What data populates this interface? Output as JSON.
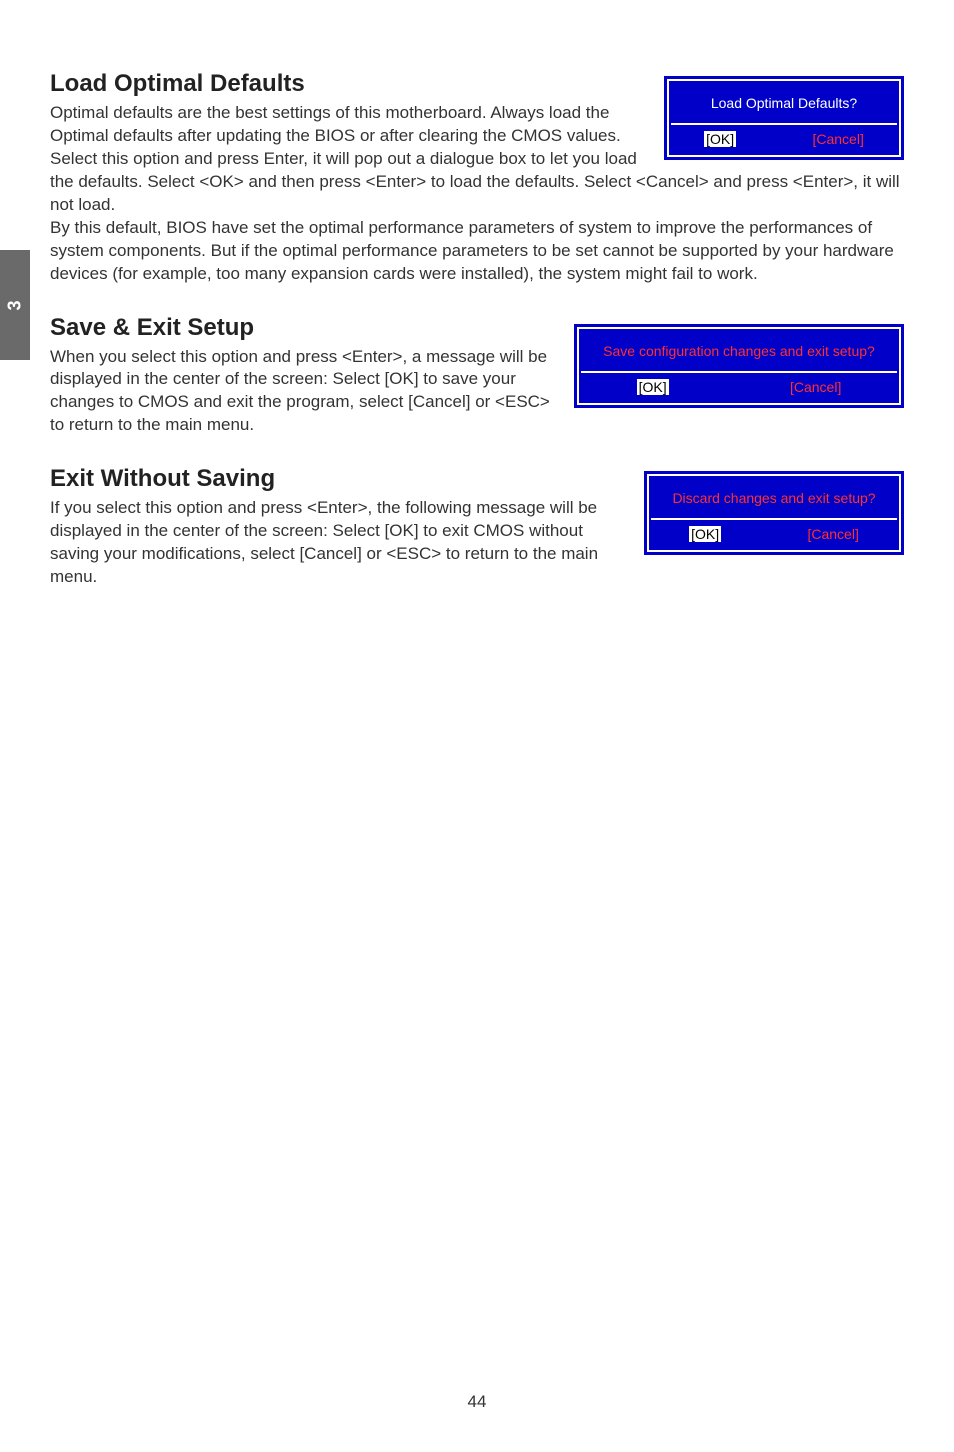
{
  "sideTab": "3",
  "section1": {
    "heading": "Load Optimal Defaults",
    "para1": "Optimal defaults are the best settings of this motherboard. Always load the Optimal defaults after updating the BIOS or after clearing the CMOS values.",
    "para2": "Select this option and press Enter, it will pop out a dialogue box to let you load the defaults. Select <OK> and then press <Enter> to load the defaults. Select <Cancel> and press <Enter>, it will not load.",
    "para3": "By this default, BIOS have set the optimal performance parameters of system to improve the performances of system components. But if the optimal performance parameters to be set cannot be supported by your hardware devices (for example, too many expansion cards were installed), the system might fail to work.",
    "dialog": {
      "title": "Load Optimal Defaults?",
      "ok": "[OK]",
      "cancel": "[Cancel]"
    }
  },
  "section2": {
    "heading": "Save & Exit Setup",
    "para1": "When you select this option and press <Enter>, a message will be displayed in the center of the screen: Select [OK] to save your changes to CMOS and exit the program, select [Cancel] or <ESC> to return to the main menu.",
    "dialog": {
      "title": "Save configuration changes and exit setup?",
      "ok": "[OK]",
      "cancel": "[Cancel]"
    }
  },
  "section3": {
    "heading": "Exit Without Saving",
    "para1": "If you select this option and press <Enter>, the following message will be displayed in the center of the screen: Select [OK] to exit CMOS without saving your modifications, select [Cancel] or <ESC> to return to the main menu.",
    "dialog": {
      "title": "Discard changes and exit setup?",
      "ok": "[OK]",
      "cancel": "[Cancel]"
    }
  },
  "pageNumber": "44"
}
